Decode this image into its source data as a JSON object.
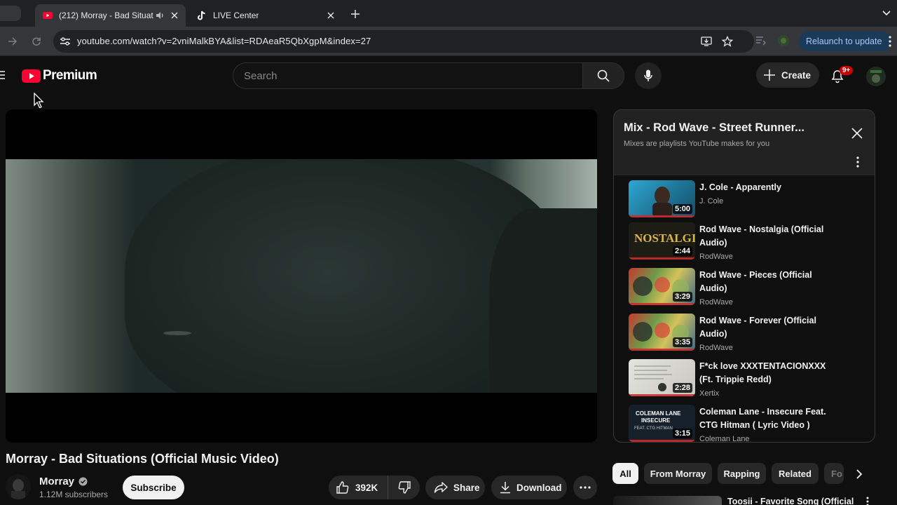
{
  "browser": {
    "tabs": [
      {
        "title": "(212) Morray - Bad Situat",
        "favicon": "youtube-icon",
        "audio": "speaker-icon",
        "active": true
      },
      {
        "title": "LIVE Center",
        "favicon": "tiktok-icon",
        "active": false
      }
    ],
    "url": "youtube.com/watch?v=2vniMalkBYA&list=RDAeaR5QbXgpM&index=27",
    "relaunch_label": "Relaunch to update"
  },
  "header": {
    "logo_text": "Premium",
    "search_placeholder": "Search",
    "create_label": "Create",
    "notification_badge": "9+"
  },
  "video": {
    "title": "Morray - Bad Situations (Official Music Video)",
    "channel": "Morray",
    "subscribers": "1.12M subscribers",
    "subscribe_label": "Subscribe",
    "likes": "392K",
    "share_label": "Share",
    "download_label": "Download"
  },
  "playlist": {
    "title": "Mix - Rod Wave - Street Runner...",
    "subtitle": "Mixes are playlists YouTube makes for you",
    "items": [
      {
        "title": "J. Cole - Apparently",
        "channel": "J. Cole",
        "duration": "5:00",
        "thumb_color": "#2a8fb5"
      },
      {
        "title": "Rod Wave - Nostalgia (Official Audio)",
        "channel": "RodWave",
        "duration": "2:44",
        "thumb_color": "#2b2a1d"
      },
      {
        "title": "Rod Wave - Pieces (Official Audio)",
        "channel": "RodWave",
        "duration": "3:29",
        "thumb_color": "#6f8a4a"
      },
      {
        "title": "Rod Wave - Forever (Official Audio)",
        "channel": "RodWave",
        "duration": "3:35",
        "thumb_color": "#6f8a4a"
      },
      {
        "title": "F*ck love XXXTENTACIONXXX (Ft. Trippie Redd)",
        "channel": "Xertix",
        "duration": "2:28",
        "thumb_color": "#d8d8d2"
      },
      {
        "title": "Coleman Lane - Insecure Feat. CTG Hitman ( Lyric Video )",
        "channel": "Coleman Lane",
        "duration": "3:15",
        "thumb_color": "#1d2a36"
      }
    ]
  },
  "chips": [
    "All",
    "From Morray",
    "Rapping",
    "Related",
    "Fo"
  ],
  "recommendation": {
    "title": "Toosii - Favorite Song (Official"
  },
  "colors": {
    "background": "#0f0f0f",
    "youtube_red": "#ff0033",
    "relaunch_bg": "#1b3a57"
  }
}
